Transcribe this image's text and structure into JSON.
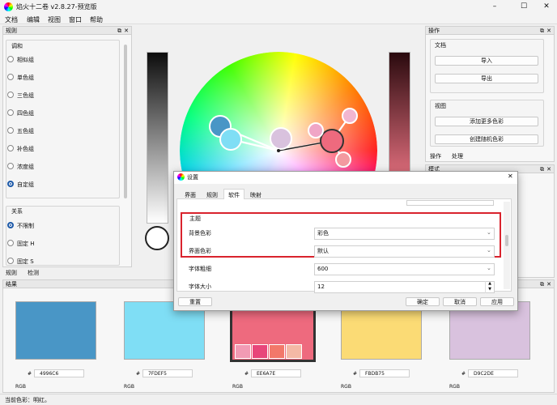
{
  "app": {
    "title": "焰火十二卷 v2.8.27-预览版"
  },
  "window_controls": {
    "minimize": "–",
    "maximize": "☐",
    "close": "✕"
  },
  "menu": [
    "文档",
    "编辑",
    "视图",
    "窗口",
    "帮助"
  ],
  "rules_panel": {
    "title": "规则",
    "group_harmony": "调和",
    "harmony_items": [
      "相似组",
      "单色组",
      "三色组",
      "四色组",
      "五色组",
      "补色组",
      "浓度组",
      "自定组"
    ],
    "selected_harmony": "自定组",
    "group_relation": "关系",
    "relation_items": [
      "不限制",
      "固定 H",
      "固定 S"
    ],
    "selected_relation": "不限制",
    "bottom_tabs": [
      "规则",
      "检测"
    ]
  },
  "operations_panel": {
    "title": "操作",
    "group_document": "文档",
    "import": "导入",
    "export": "导出",
    "group_view": "视图",
    "add_colors": "添加更多色彩",
    "create_random": "创建随机色彩",
    "tabs": [
      "操作",
      "处理"
    ]
  },
  "mode_panel": {
    "title": "模式"
  },
  "results_panel": {
    "title": "结果",
    "swatches": [
      {
        "hex": "4996C6",
        "color": "#4996C6",
        "model": "RGB"
      },
      {
        "hex": "7FDEF5",
        "color": "#7FDEF5",
        "model": "RGB"
      },
      {
        "hex": "EE6A7E",
        "color": "#EE6A7E",
        "model": "RGB"
      },
      {
        "hex": "FBDB75",
        "color": "#FBDB75",
        "model": "RGB"
      },
      {
        "hex": "D9C2DE",
        "color": "#D9C2DE",
        "model": "RGB"
      }
    ],
    "hash": "#",
    "selected_strip": [
      "#F29BB4",
      "#E8467A",
      "#F2786A",
      "#F4B9A6"
    ]
  },
  "status": {
    "text": "当前色彩：明红。"
  },
  "settings_dialog": {
    "title": "设置",
    "tabs": [
      "界面",
      "规则",
      "软件",
      "映射"
    ],
    "active_tab": "软件",
    "section_theme": "主题",
    "rows": [
      {
        "label": "背景色彩",
        "value": "彩色"
      },
      {
        "label": "界面色彩",
        "value": "默认"
      },
      {
        "label": "字体粗细",
        "value": "600"
      },
      {
        "label": "字体大小",
        "value": "12"
      }
    ],
    "buttons": {
      "reset": "重置",
      "ok": "确定",
      "cancel": "取消",
      "apply": "应用"
    },
    "highlight_color": "#d9232d"
  },
  "colors": {
    "accent": "#1e5aa8",
    "highlight": "#d9232d"
  }
}
